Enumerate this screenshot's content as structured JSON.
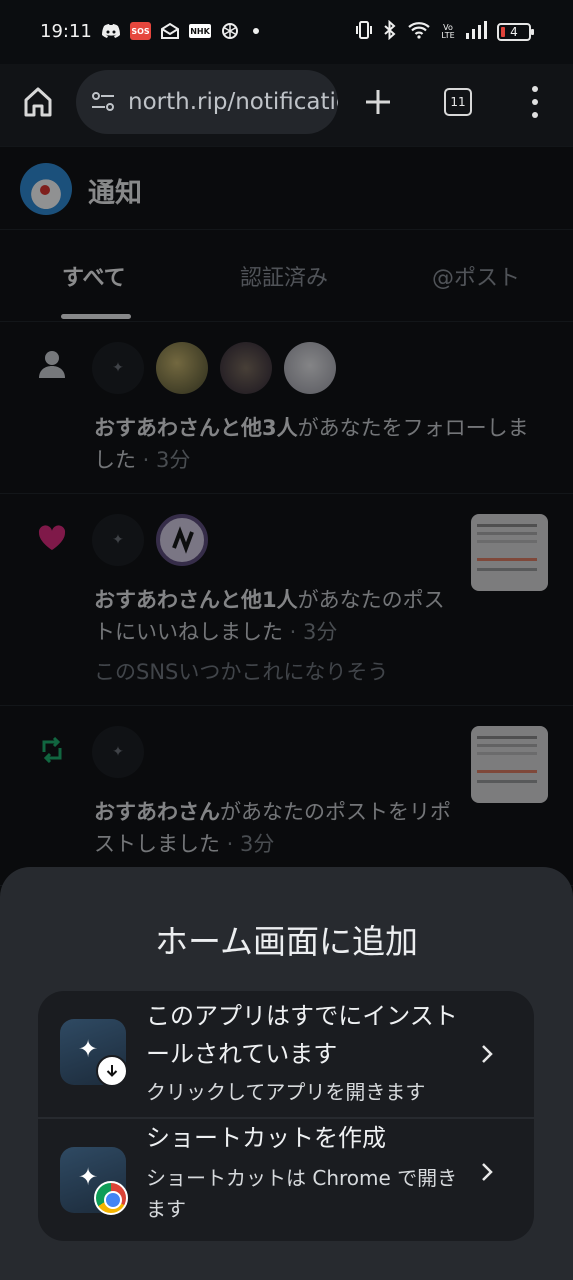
{
  "status_bar": {
    "time": "19:11",
    "sos_label": "SOS",
    "nhk_label": "NHK",
    "network_label": "Vo LTE",
    "battery_level": "4"
  },
  "browser": {
    "url": "north.rip/notifications",
    "tab_count": "11"
  },
  "page": {
    "title": "通知",
    "tabs": [
      {
        "label": "すべて",
        "active": true
      },
      {
        "label": "認証済み",
        "active": false
      },
      {
        "label": "@ポスト",
        "active": false
      }
    ],
    "notifications": [
      {
        "type": "follow",
        "icon": "person-icon",
        "actor": "おすあわさんと他3人",
        "action": "があなたをフォローしました",
        "time": " · 3分"
      },
      {
        "type": "like",
        "icon": "heart-icon",
        "actor": "おすあわさんと他1人",
        "action": "があなたのポストにいいねしました",
        "time": " · 3分",
        "preview": "このSNSいつかこれになりそう"
      },
      {
        "type": "repost",
        "icon": "repost-icon",
        "actor": "おすあわさん",
        "action": "があなたのポストをリポストしました",
        "time": " · 3分"
      }
    ]
  },
  "sheet": {
    "title": "ホーム画面に追加",
    "options": [
      {
        "title": "このアプリはすでにインストールされています",
        "subtitle": "クリックしてアプリを開きます",
        "icon": "app-download-icon"
      },
      {
        "title": "ショートカットを作成",
        "subtitle": "ショートカットは Chrome で開きます",
        "icon": "chrome-shortcut-icon"
      }
    ]
  },
  "colors": {
    "background": "#0a0b0d",
    "sheet": "#272a2f",
    "like": "#e0267a",
    "repost": "#17b26a"
  }
}
